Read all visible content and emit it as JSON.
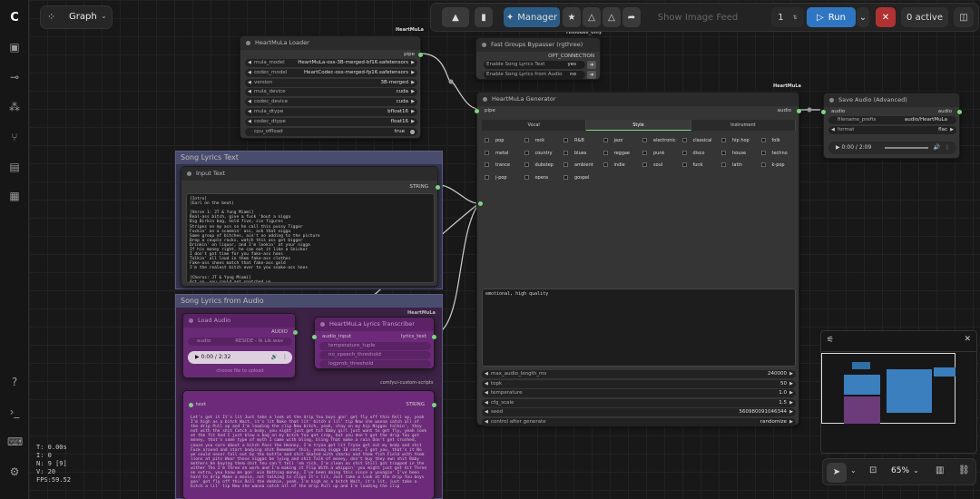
{
  "header": {
    "graph_tab_label": "Graph",
    "manager_label": "Manager",
    "show_image_feed": "Show Image Feed",
    "queue_count": "1",
    "run_label": "Run",
    "active_label": "0 active"
  },
  "stats": {
    "t": "T: 0.00s",
    "i": "I: 0",
    "n": "N: 9 [9]",
    "v": "V: 20",
    "fps": "FPS:59.52"
  },
  "nodes": {
    "loader": {
      "tag": "HeartMuLa",
      "title": "HeartMuLa Loader",
      "output": "pipe",
      "widgets": [
        {
          "label": "mula_model",
          "value": "HeartMuLa-oss-3B-merged-bf16.safetensors"
        },
        {
          "label": "codec_model",
          "value": "HeartCodec-oss-merged-fp16.safetensors"
        },
        {
          "label": "version",
          "value": "3B-merged"
        },
        {
          "label": "mula_device",
          "value": "cuda"
        },
        {
          "label": "codec_device",
          "value": "cuda"
        },
        {
          "label": "mula_dtype",
          "value": "bfloat16"
        },
        {
          "label": "codec_dtype",
          "value": "float16"
        },
        {
          "label": "cpu_offload",
          "value": "true"
        }
      ]
    },
    "bypasser": {
      "tag": "rmnodes_only",
      "title": "Fast Groups Bypasser (rgthree)",
      "output": "OPT_CONNECTION",
      "widgets": [
        {
          "label": "Enable Song Lyrics Text",
          "value": "yes"
        },
        {
          "label": "Enable Song Lyrics from Audio",
          "value": "no"
        }
      ]
    },
    "generator": {
      "tag": "HeartMuLa",
      "title": "HeartMuLa Generator",
      "input": "pipe",
      "output": "audio",
      "tabs": [
        "Vocal",
        "Style",
        "Instrument"
      ],
      "active_tab": "Style",
      "styles": [
        "pop",
        "rock",
        "R&B",
        "jazz",
        "electronic",
        "classical",
        "hip hop",
        "folk",
        "metal",
        "country",
        "blues",
        "reggae",
        "punk",
        "disco",
        "house",
        "techno",
        "trance",
        "dubstep",
        "ambient",
        "indie",
        "soul",
        "funk",
        "latin",
        "k-pop",
        "j-pop",
        "opera",
        "gospel"
      ],
      "tags_text": "emotional, high quality",
      "widgets": [
        {
          "label": "max_audio_length_ms",
          "value": "240000"
        },
        {
          "label": "topk",
          "value": "50"
        },
        {
          "label": "temperature",
          "value": "1.0"
        },
        {
          "label": "cfg_scale",
          "value": "1.5"
        },
        {
          "label": "seed",
          "value": "560980091046344"
        },
        {
          "label": "control after generate",
          "value": "randomize"
        }
      ]
    },
    "save_audio": {
      "title": "Save Audio (Advanced)",
      "input": "audio",
      "output": "audio",
      "widgets": [
        {
          "label": "filename_prefix",
          "value": "audio/HeartMuLa"
        },
        {
          "label": "format",
          "value": "flac"
        }
      ],
      "player_time": "0:00 / 2:09"
    }
  },
  "groups": {
    "lyrics_text": {
      "title": "Song Lyrics Text",
      "node_title": "Input Text",
      "output": "STRING",
      "text": "[Intro]\n(Earl on the beat)\n\n[Verse 1: JT & Yung Miami]\nReal-ass bitch, give a fuck 'bout a nigga\nBig Birkin bag, hold five, six figures\nStripes on my ass so he call this pussy Tigger\nFuckin' on a scammin' ass, ask that nigga\nSame group of bitches, ain't no adding to the picture\nDrop a couple racks, watch this ass get bigger\nDrinkin' on liquor, and I'm lookin' at your nigga\nIf his money right, he can eat it like a Snicker\nI don't got time for you fake-ass hoes\nTalkin' all loud in them fake-ass clothes\nFake-ass shoes match that fake-ass gold\nI'm the realest bitch ever to you snake-ass hoes\n\n[Chorus: JT & Yung Miami]\nAct up, you could get snatched up"
    },
    "lyrics_audio": {
      "title": "Song Lyrics from Audio",
      "tag": "HeartMuLa",
      "load_audio_title": "Load Audio",
      "load_audio_output": "AUDIO",
      "load_audio_widget": "audio",
      "load_audio_value": "RESIDE - Ik Lik.wav",
      "load_audio_time": "0:00 / 2:32",
      "upload_label": "choose file to upload",
      "transcribe_title": "HeartMuLa Lyrics Transcriber",
      "transcribe_input": "audio_input",
      "transcribe_output": "lyrics_text",
      "transcribe_widgets": [
        "temperature_tuple",
        "no_speech_threshold",
        "logprob_threshold"
      ],
      "show_text_tag": "comfyui-custom-scripts",
      "show_text_input": "text",
      "show_text_output": "STRING",
      "show_text": "Let's get it It's lit Just take a look at the drip You boys gon' get fly off this Roll up, yeah I'm high as a bitch Wait, it's lit Nake that lit' bitch a lil' tip Now she wanna catch all of the drip Pull up and I'm loading the clip Now bitch, yeah, stay on my hip Niggas talkin', they not with the shit Catch a body, you night just get hit Baby girl just want to get fly, yeah look at the fit And I just blow a bag on my bitch You got crap, but you don't got the drip You got money, that's some type of myth I came with bling, bling That make a rain Don't get crushed, cause you care about a bitch Pass the Hennny, I'm tryna get lit Tryna get out my body and shit Fuck around and start bodying shit Remember this, young nigga 10 cent, I got you, that's it No we could never fall out by the bottle and shit Skated with sharks and them fish Field with them lions at pits Wear these niggas be lying and shit Talk of money, don't buy they own shit Baby mothers be buying them shit You can't tell 'em rich, I'm clean as shit Still got trapped in the wither Tho I'm Three on work and I'm making it Flip With a whippin' you might just get hit Three on extra, you know me gon' win Nothing money, I've been doing this since a youngin' I've been hard to drip Make a movie, not talking to clips It's lit, Just take a look at the drip You boys gon' get fly off this Roll the doobie, yeah, I'm high as a bitch Wait, it's lit, just take a bitch a lil' tip Now she wanna catch all of the drip Pull up and I'm loading the clip"
    }
  },
  "zoom": "65%"
}
